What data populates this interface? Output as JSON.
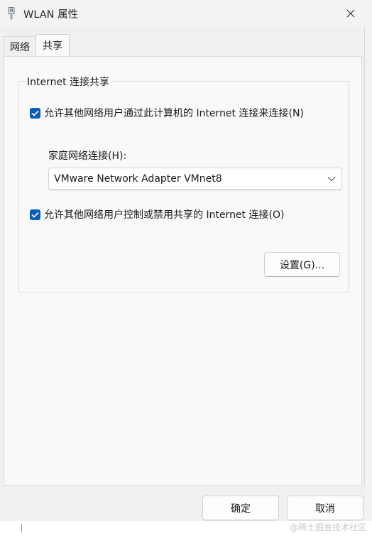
{
  "window": {
    "title": "WLAN 属性",
    "close_label": "✕"
  },
  "tabs": [
    {
      "label": "网络",
      "active": false
    },
    {
      "label": "共享",
      "active": true
    }
  ],
  "group": {
    "title": "Internet 连接共享",
    "allow_share": {
      "label": "允许其他网络用户通过此计算机的 Internet 连接来连接(N)",
      "checked": true
    },
    "home_network": {
      "label": "家庭网络连接(H):",
      "selected": "VMware Network Adapter VMnet8"
    },
    "allow_control": {
      "label": "允许其他网络用户控制或禁用共享的 Internet 连接(O)",
      "checked": true
    },
    "settings_button": "设置(G)..."
  },
  "footer": {
    "ok_label": "确定",
    "cancel_label": "取消"
  },
  "watermark": "@稀土掘金技术社区",
  "colors": {
    "accent": "#0a5fb8",
    "panel_bg": "#f9f9f9",
    "window_bg": "#f0f0f0"
  }
}
